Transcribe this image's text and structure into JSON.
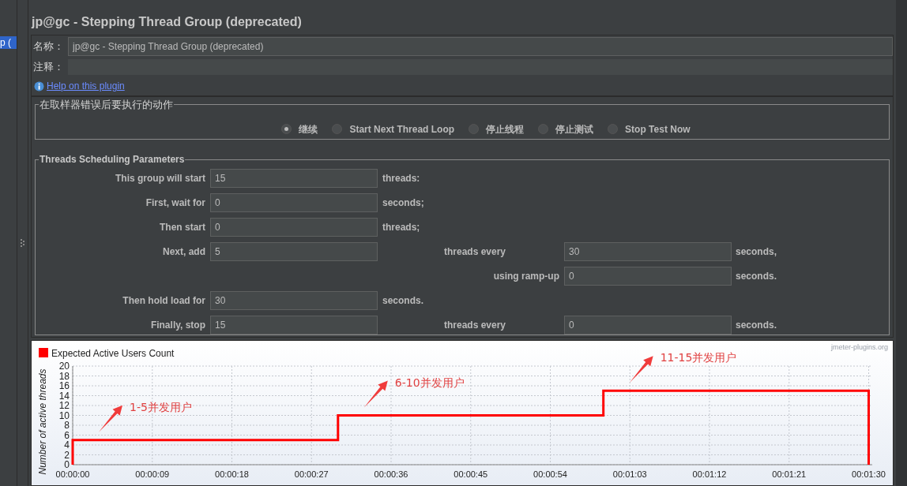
{
  "sidebar": {
    "items": [
      {
        "label": "p (",
        "selected": true
      }
    ]
  },
  "title": "jp@gc - Stepping Thread Group (deprecated)",
  "name_field": {
    "label": "名称：",
    "value": "jp@gc - Stepping Thread Group (deprecated)"
  },
  "comment_field": {
    "label": "注释："
  },
  "help_link": "Help on this plugin",
  "error_action": {
    "legend": "在取样器错误后要执行的动作",
    "options": [
      {
        "label": "继续",
        "selected": true
      },
      {
        "label": "Start Next Thread Loop",
        "selected": false
      },
      {
        "label": "停止线程",
        "selected": false
      },
      {
        "label": "停止测试",
        "selected": false
      },
      {
        "label": "Stop Test Now",
        "selected": false
      }
    ]
  },
  "scheduling": {
    "legend": "Threads Scheduling Parameters",
    "rows": [
      {
        "kind": "primary",
        "label": "This group will start",
        "value": "15",
        "unit": "threads:"
      },
      {
        "kind": "primary",
        "label": "First, wait for",
        "value": "0",
        "unit": "seconds;"
      },
      {
        "kind": "primary",
        "label": "Then start",
        "value": "0",
        "unit": "threads;"
      },
      {
        "kind": "primary",
        "label": "Next, add",
        "value": "5",
        "unit": "",
        "extra": {
          "label": "threads every",
          "value": "30",
          "unit": "seconds,"
        }
      },
      {
        "kind": "secondary",
        "label": "using ramp-up",
        "value": "0",
        "unit": "seconds."
      },
      {
        "kind": "primary",
        "label": "Then hold load for",
        "value": "30",
        "unit": "seconds."
      },
      {
        "kind": "primary",
        "label": "Finally, stop",
        "value": "15",
        "unit": "",
        "extra": {
          "label": "threads every",
          "value": "0",
          "unit": "seconds."
        }
      }
    ]
  },
  "chart": {
    "credit": "jmeter-plugins.org",
    "chart_data": {
      "type": "line",
      "ylabel": "Number of active threads",
      "x": [
        0,
        0,
        30,
        30,
        60,
        60,
        90,
        90
      ],
      "series": [
        {
          "name": "Expected Active Users Count",
          "color": "#ff0000",
          "values": [
            0,
            5,
            5,
            10,
            10,
            15,
            15,
            0
          ]
        }
      ],
      "xlim": [
        0,
        90.4
      ],
      "ylim": [
        0,
        20
      ],
      "xticks": [
        {
          "value": 0,
          "label": "00:00:00"
        },
        {
          "value": 9,
          "label": "00:00:09"
        },
        {
          "value": 18,
          "label": "00:00:18"
        },
        {
          "value": 27,
          "label": "00:00:27"
        },
        {
          "value": 36,
          "label": "00:00:36"
        },
        {
          "value": 45,
          "label": "00:00:45"
        },
        {
          "value": 54,
          "label": "00:00:54"
        },
        {
          "value": 63,
          "label": "00:01:03"
        },
        {
          "value": 72,
          "label": "00:01:12"
        },
        {
          "value": 81,
          "label": "00:01:21"
        },
        {
          "value": 90,
          "label": "00:01:30"
        }
      ],
      "yticks": [
        0,
        2,
        4,
        6,
        8,
        10,
        12,
        14,
        16,
        18,
        20
      ],
      "annotations": [
        "1-5并发用户",
        "6-10并发用户",
        "11-15并发用户"
      ],
      "grid": true
    }
  }
}
